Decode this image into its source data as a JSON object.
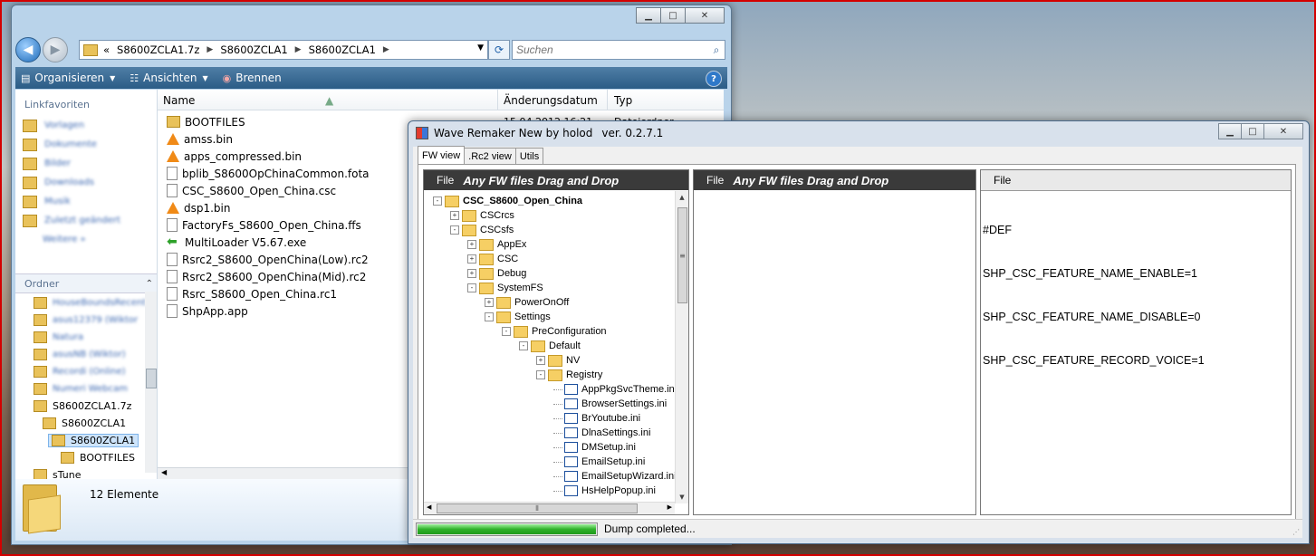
{
  "explorer": {
    "breadcrumb": [
      "S8600ZCLA1.7z",
      "S8600ZCLA1",
      "S8600ZCLA1"
    ],
    "breadcrumb_prefix": "«",
    "search_placeholder": "Suchen",
    "toolbar": {
      "organize": "Organisieren",
      "views": "Ansichten",
      "burn": "Brennen"
    },
    "nav_heading": "Linkfavoriten",
    "favorites": [
      "Vorlagen",
      "Dokumente",
      "Bilder",
      "Downloads",
      "Musik",
      "Zuletzt geändert",
      "Weitere »"
    ],
    "ordner_label": "Ordner",
    "folder_tree": [
      {
        "label": "HouseBoundsRecent"
      },
      {
        "label": "asus12379 (Wiktor"
      },
      {
        "label": "Natura"
      },
      {
        "label": "asusNB (Wiktor)"
      },
      {
        "label": "Recordi (Online)"
      },
      {
        "label": "Numeri Webcam"
      },
      {
        "label": "S8600ZCLA1.7z"
      },
      {
        "label": "S8600ZCLA1"
      },
      {
        "label": "S8600ZCLA1"
      },
      {
        "label": "BOOTFILES"
      },
      {
        "label": "sTune"
      }
    ],
    "columns": {
      "name": "Name",
      "date": "Änderungsdatum",
      "type": "Typ"
    },
    "visible_date": "15.04.2012 16:21",
    "visible_type": "Dateiordner",
    "files": [
      {
        "name": "BOOTFILES",
        "icon": "folder-icon"
      },
      {
        "name": "amss.bin",
        "icon": "vlc-cone-icon"
      },
      {
        "name": "apps_compressed.bin",
        "icon": "vlc-cone-icon"
      },
      {
        "name": "bplib_S8600OpChinaCommon.fota",
        "icon": "file-icon"
      },
      {
        "name": "CSC_S8600_Open_China.csc",
        "icon": "file-icon"
      },
      {
        "name": "dsp1.bin",
        "icon": "vlc-cone-icon"
      },
      {
        "name": "FactoryFs_S8600_Open_China.ffs",
        "icon": "file-icon"
      },
      {
        "name": "MultiLoader V5.67.exe",
        "icon": "green-arrow-icon"
      },
      {
        "name": "Rsrc2_S8600_OpenChina(Low).rc2",
        "icon": "file-icon"
      },
      {
        "name": "Rsrc2_S8600_OpenChina(Mid).rc2",
        "icon": "file-icon"
      },
      {
        "name": "Rsrc_S8600_Open_China.rc1",
        "icon": "file-icon"
      },
      {
        "name": "ShpApp.app",
        "icon": "file-icon"
      }
    ],
    "item_count": "12 Elemente"
  },
  "wave": {
    "title": "Wave Remaker New by holod",
    "version": "ver. 0.2.7.1",
    "tabs": [
      "FW view",
      ".Rc2 view",
      "Utils"
    ],
    "panel1": {
      "file_label": "File",
      "hint": "Any FW files Drag and Drop"
    },
    "panel2": {
      "file_label": "File",
      "hint": "Any FW files Drag and Drop"
    },
    "panel3": {
      "file_label": "File"
    },
    "tree": [
      {
        "label": "CSC_S8600_Open_China",
        "type": "folder",
        "pm": "-",
        "level": 0,
        "bold": true
      },
      {
        "label": "CSCrcs",
        "type": "folder",
        "pm": "+",
        "level": 1
      },
      {
        "label": "CSCsfs",
        "type": "folder",
        "pm": "-",
        "level": 1
      },
      {
        "label": "AppEx",
        "type": "folder",
        "pm": "+",
        "level": 2
      },
      {
        "label": "CSC",
        "type": "folder",
        "pm": "+",
        "level": 2
      },
      {
        "label": "Debug",
        "type": "folder",
        "pm": "+",
        "level": 2
      },
      {
        "label": "SystemFS",
        "type": "folder",
        "pm": "-",
        "level": 2
      },
      {
        "label": "PowerOnOff",
        "type": "folder",
        "pm": "+",
        "level": 3
      },
      {
        "label": "Settings",
        "type": "folder",
        "pm": "-",
        "level": 3
      },
      {
        "label": "PreConfiguration",
        "type": "folder",
        "pm": "-",
        "level": 4
      },
      {
        "label": "Default",
        "type": "folder",
        "pm": "-",
        "level": 5
      },
      {
        "label": "NV",
        "type": "folder",
        "pm": "+",
        "level": 6
      },
      {
        "label": "Registry",
        "type": "folder",
        "pm": "-",
        "level": 6
      },
      {
        "label": "AppPkgSvcTheme.ini",
        "type": "ini",
        "level": 7
      },
      {
        "label": "BrowserSettings.ini",
        "type": "ini",
        "level": 7
      },
      {
        "label": "BrYoutube.ini",
        "type": "ini",
        "level": 7
      },
      {
        "label": "DlnaSettings.ini",
        "type": "ini",
        "level": 7
      },
      {
        "label": "DMSetup.ini",
        "type": "ini",
        "level": 7
      },
      {
        "label": "EmailSetup.ini",
        "type": "ini",
        "level": 7
      },
      {
        "label": "EmailSetupWizard.ini",
        "type": "ini",
        "level": 7
      },
      {
        "label": "HsHelpPopup.ini",
        "type": "ini",
        "level": 7
      }
    ],
    "csc_lines": [
      "#DEF",
      "SHP_CSC_FEATURE_NAME_ENABLE=1",
      "SHP_CSC_FEATURE_NAME_DISABLE=0",
      "SHP_CSC_FEATURE_RECORD_VOICE=1"
    ],
    "progress": 1.0,
    "status": "Dump completed..."
  }
}
